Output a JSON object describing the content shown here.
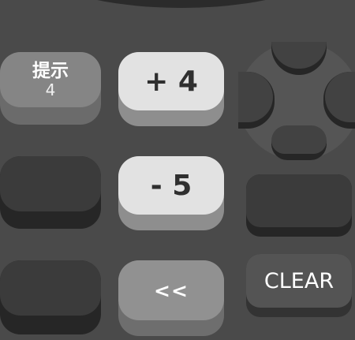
{
  "hint_key": {
    "label": "提示",
    "count": "4"
  },
  "keys": {
    "plus": "+ 4",
    "minus": "- 5",
    "back": "<<",
    "clear": "CLEAR"
  },
  "colors": {
    "background": "#4a4a4a",
    "light_key": "#e2e2e2",
    "dark_key": "#3b3b3b",
    "mid_key": "#919191"
  },
  "dpad": {
    "directions": [
      "up",
      "down",
      "left",
      "right"
    ]
  }
}
